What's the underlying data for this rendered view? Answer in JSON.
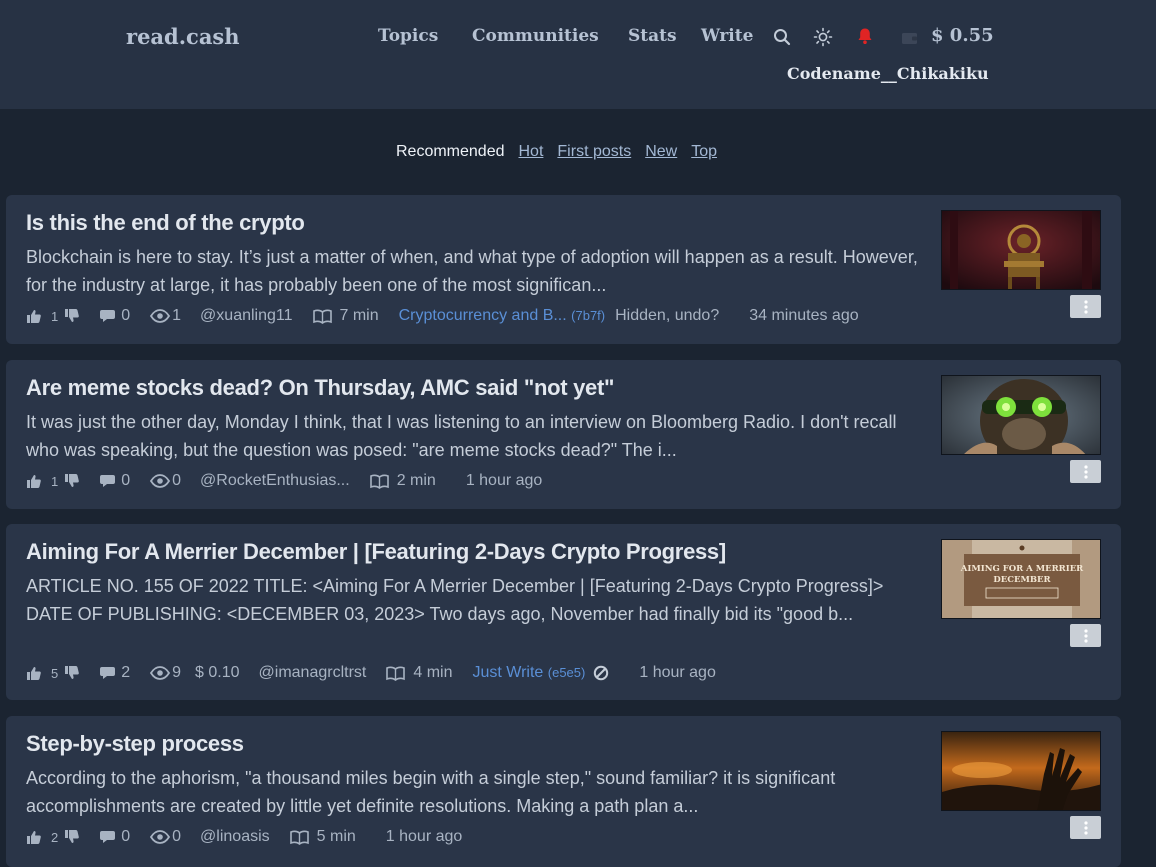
{
  "header": {
    "logo": "read.cash",
    "nav": [
      "Topics",
      "Communities",
      "Stats",
      "Write"
    ],
    "balance": "$ 0.55",
    "username": "Codename__Chikakiku",
    "icons": [
      "search-icon",
      "sun-icon",
      "bell-icon",
      "wallet-icon"
    ],
    "colors": {
      "bell": "#e02424",
      "background": "#273244"
    }
  },
  "tabs": [
    "Recommended",
    "Hot",
    "First posts",
    "New",
    "Top"
  ],
  "articles": [
    {
      "title": "Is this the end of the crypto",
      "excerpt": "Blockchain is here to stay. It’s just a matter of when, and what type of adoption will happen as a result. However, for the industry at large, it has probably been one of the most significan...",
      "upvotes": "1",
      "comments": "0",
      "views": "1",
      "author": "@xuanling11",
      "read_time": "7 min",
      "community": "Cryptocurrency and B...",
      "community_hash": "(7b7f)",
      "hidden_note": "Hidden, undo?",
      "time": "34 minutes ago"
    },
    {
      "title": "Are meme stocks dead? On Thursday, AMC said \"not yet\"",
      "excerpt": "It was just the other day, Monday I think, that I was listening to an interview on Bloomberg Radio. I don't recall who was speaking, but the question was posed: \"are meme stocks dead?\" The i...",
      "upvotes": "1",
      "comments": "0",
      "views": "0",
      "author": "@RocketEnthusias...",
      "read_time": "2 min",
      "time": "1 hour ago"
    },
    {
      "title": "Aiming For A Merrier December | [Featuring 2-Days Crypto Progress]",
      "excerpt": "ARTICLE NO. 155 OF 2022 TITLE: <Aiming For A Merrier December | [Featuring 2-Days Crypto Progress]> DATE OF PUBLISHING: <DECEMBER 03, 2023> Two days ago, November had finally bid its \"good b...",
      "upvotes": "5",
      "comments": "2",
      "views": "9",
      "tips": "$ 0.10",
      "author": "@imanagrcltrst",
      "read_time": "4 min",
      "community": "Just Write",
      "community_hash": "(e5e5)",
      "time": "1 hour ago",
      "thumb_text": [
        "AIMING FOR A MERRIER",
        "DECEMBER"
      ]
    },
    {
      "title": "Step-by-step process",
      "excerpt": "According to the aphorism, \"a thousand miles begin with a single step,\" sound familiar? it is significant accomplishments are created by little yet definite resolutions. Making a path plan a...",
      "upvotes": "2",
      "comments": "0",
      "views": "0",
      "author": "@linoasis",
      "read_time": "5 min",
      "time": "1 hour ago"
    }
  ]
}
